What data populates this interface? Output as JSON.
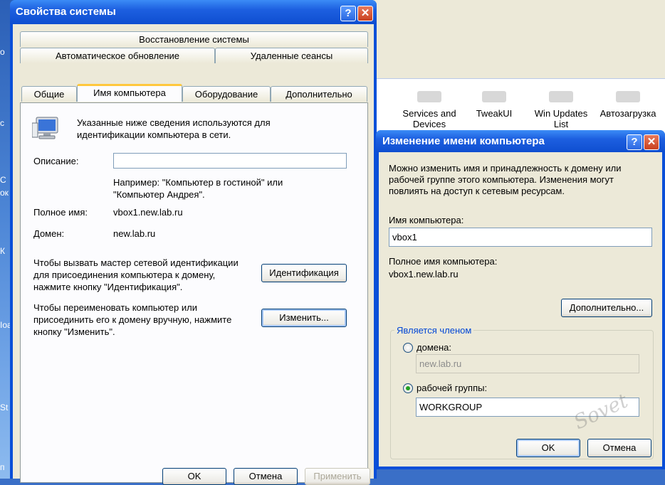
{
  "desktop": {
    "labels": [
      "о",
      "c",
      "С",
      "ок",
      "К",
      "Ioa",
      "St",
      "п"
    ]
  },
  "background_window": {
    "items": [
      "Services and Devices",
      "TweakUI",
      "Win Updates List",
      "Автозагрузка"
    ]
  },
  "main_window": {
    "title": "Свойства системы",
    "help_button": "?",
    "close_button": "✕",
    "tabs_row1": [
      "Восстановление системы"
    ],
    "tabs_row2": [
      "Автоматическое обновление",
      "Удаленные сеансы"
    ],
    "tabs_row3": [
      "Общие",
      "Имя компьютера",
      "Оборудование",
      "Дополнительно"
    ],
    "active_tab": "Имя компьютера",
    "intro_line1": "Указанные ниже сведения используются для",
    "intro_line2": "идентификации компьютера в сети.",
    "description_label": "Описание:",
    "description_value": "",
    "example_line1": "Например: \"Компьютер в гостиной\" или",
    "example_line2": "\"Компьютер Андрея\".",
    "fullname_label": "Полное имя:",
    "fullname_value": "vbox1.new.lab.ru",
    "domain_label": "Домен:",
    "domain_value": "new.lab.ru",
    "wizard_line1": "Чтобы вызвать мастер сетевой идентификации",
    "wizard_line2": "для присоединения компьютера к домену,",
    "wizard_line3": "нажмите кнопку \"Идентификация\".",
    "identification_button": "Идентификация",
    "rename_line1": "Чтобы переименовать компьютер или",
    "rename_line2": "присоединить его к домену вручную, нажмите",
    "rename_line3": "кнопку \"Изменить\".",
    "change_button": "Изменить...",
    "ok_button": "OK",
    "cancel_button": "Отмена",
    "apply_button": "Применить"
  },
  "dialog": {
    "title": "Изменение имени компьютера",
    "help_button": "?",
    "close_button": "✕",
    "info_line1": "Можно изменить имя и принадлежность к домену или",
    "info_line2": "рабочей группе этого компьютера. Изменения могут",
    "info_line3": "повлиять на доступ к сетевым ресурсам.",
    "computer_name_label": "Имя компьютера:",
    "computer_name_value": "vbox1",
    "full_name_label": "Полное имя компьютера:",
    "full_name_value": "vbox1.new.lab.ru",
    "more_button": "Дополнительно...",
    "member_of_label": "Является членом",
    "domain_radio_label": "домена:",
    "domain_value": "new.lab.ru",
    "workgroup_radio_label": "рабочей группы:",
    "workgroup_value": "WORKGROUP",
    "selected": "workgroup",
    "ok_button": "OK",
    "cancel_button": "Отмена"
  },
  "watermark": "Sovet"
}
